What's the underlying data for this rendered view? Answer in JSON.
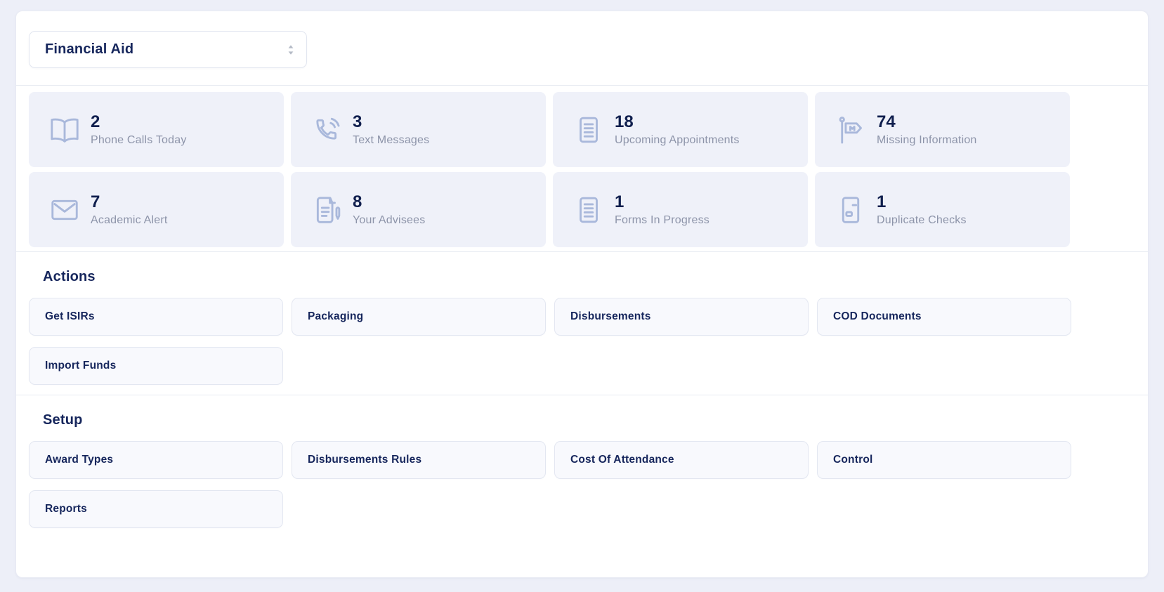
{
  "header": {
    "department_select": {
      "value": "Financial Aid"
    }
  },
  "stats": [
    {
      "icon": "book-open-icon",
      "value": "2",
      "label": "Phone Calls Today"
    },
    {
      "icon": "phone-volume-icon",
      "value": "3",
      "label": "Text Messages"
    },
    {
      "icon": "document-lines-icon",
      "value": "18",
      "label": "Upcoming Appointments"
    },
    {
      "icon": "flag-icon",
      "value": "74",
      "label": "Missing Information"
    },
    {
      "icon": "envelope-icon",
      "value": "7",
      "label": "Academic Alert"
    },
    {
      "icon": "document-pencil-icon",
      "value": "8",
      "label": "Your Advisees"
    },
    {
      "icon": "document-lines-icon",
      "value": "1",
      "label": "Forms In Progress"
    },
    {
      "icon": "money-check-icon",
      "value": "1",
      "label": "Duplicate Checks"
    }
  ],
  "sections": [
    {
      "title": "Actions",
      "buttons": [
        {
          "label": "Get ISIRs"
        },
        {
          "label": "Packaging"
        },
        {
          "label": "Disbursements"
        },
        {
          "label": "COD Documents"
        },
        {
          "label": "Import Funds"
        }
      ]
    },
    {
      "title": "Setup",
      "buttons": [
        {
          "label": "Award Types"
        },
        {
          "label": "Disbursements Rules"
        },
        {
          "label": "Cost Of Attendance"
        },
        {
          "label": "Control"
        },
        {
          "label": "Reports"
        }
      ]
    }
  ],
  "colors": {
    "page_bg": "#edeff8",
    "card_bg": "#ffffff",
    "stat_card_bg": "#eff1f9",
    "button_bg": "#f8f9fd",
    "button_border": "#e3e7f1",
    "divider": "#e7eaf1",
    "navy": "#16265c",
    "number": "#101f4e",
    "label_gray": "#8d94a9",
    "icon": "#a9b8db"
  }
}
